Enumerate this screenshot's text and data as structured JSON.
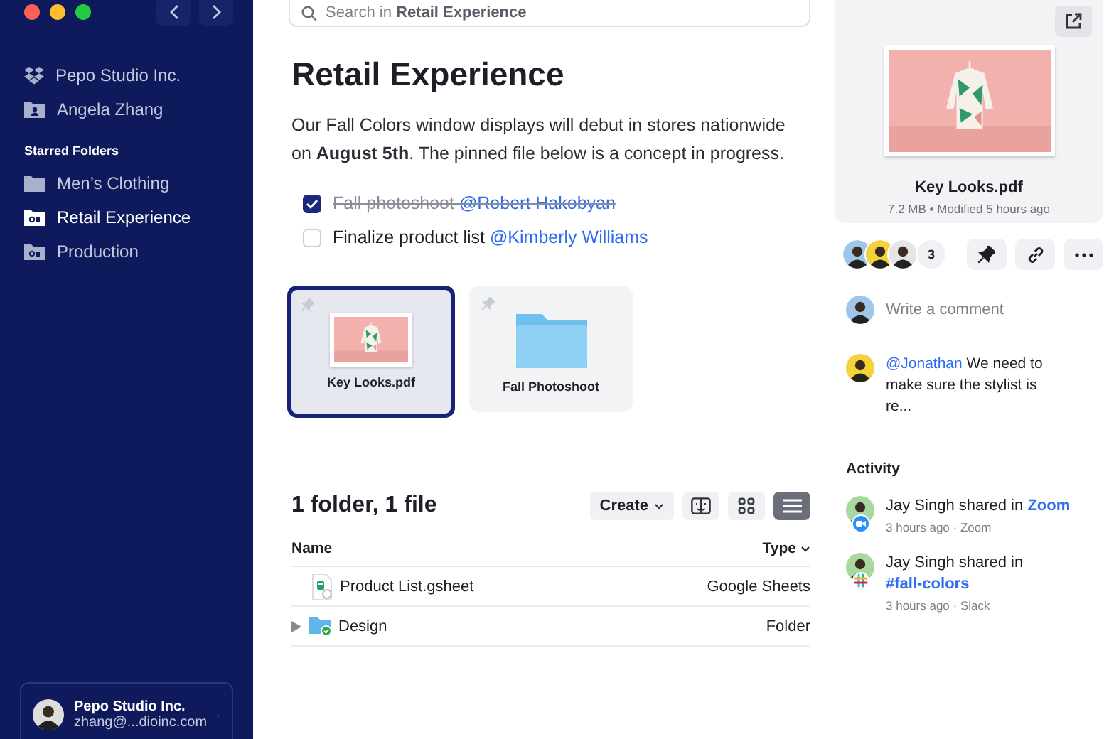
{
  "sidebar": {
    "items": [
      {
        "label": "Pepo Studio Inc.",
        "kind": "team",
        "selected": false
      },
      {
        "label": "Angela Zhang",
        "kind": "person",
        "selected": false
      }
    ],
    "section_title": "Starred Folders",
    "starred": [
      {
        "label": "Men’s Clothing",
        "kind": "folder",
        "selected": false
      },
      {
        "label": "Retail Experience",
        "kind": "shared",
        "selected": true
      },
      {
        "label": "Production",
        "kind": "shared",
        "selected": false
      }
    ],
    "account": {
      "name": "Pepo Studio Inc.",
      "email": "zhang@...dioinc.com"
    }
  },
  "search": {
    "placeholder": "Search in **Retail Experience**"
  },
  "title": "Retail Experience",
  "description": "Our Fall Colors window displays will debut in stores nationwide on **August 5th**. The pinned file below is a concept in progress.",
  "tasks": [
    {
      "text": "Fall photoshoot",
      "mention": "@Robert Hakobyan",
      "checked": true
    },
    {
      "text": "Finalize product list",
      "mention": "@Kimberly Williams",
      "checked": false
    }
  ],
  "pinned": [
    {
      "name": "Key Looks.pdf",
      "kind": "picture",
      "selected": true
    },
    {
      "name": "Fall Photoshoot",
      "kind": "folder",
      "selected": false
    }
  ],
  "listing": {
    "summary": "1 folder, 1 file",
    "create": "Create",
    "views": [
      {
        "kind": "grid",
        "selected": false
      },
      {
        "kind": "list",
        "selected": true
      }
    ],
    "columns": [
      "Name",
      "Type"
    ],
    "rows": [
      {
        "kind": "sheet",
        "name": "Product List.gsheet",
        "type": "Google Sheets"
      },
      {
        "kind": "folder",
        "name": "Design",
        "type": "Folder",
        "expanded": false
      }
    ]
  },
  "preview": {
    "name": "Key Looks.pdf",
    "meta": "7.2 MB • Modified 5 hours ago",
    "viewer_count": "3"
  },
  "comment_placeholder": "Write a comment",
  "comments": [
    {
      "mention": "@Jonathan",
      "text": "We need to make sure the stylist is re..."
    }
  ],
  "activity_title": "Activity",
  "activity": [
    {
      "text": "Jay Singh shared in",
      "link": "Zoom",
      "meta": "3 hours ago · Zoom",
      "kind": "zoom"
    },
    {
      "text": "Jay Singh shared in",
      "link": "#fall-colors",
      "meta": "3 hours ago · Slack",
      "kind": "slack"
    }
  ]
}
